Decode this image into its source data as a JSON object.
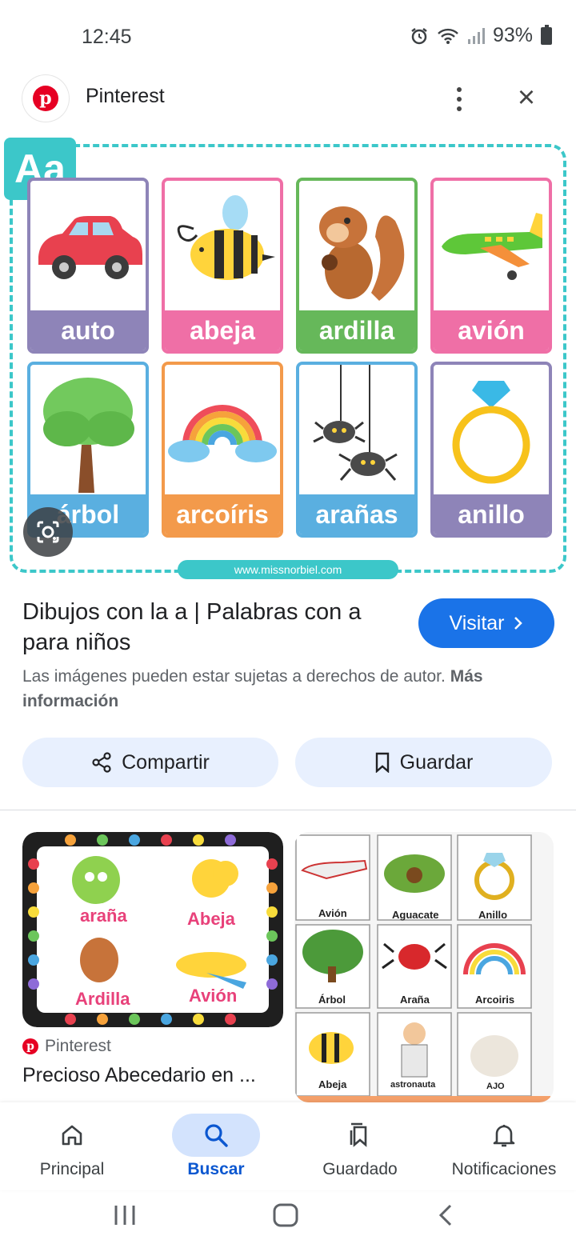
{
  "status_bar": {
    "time": "12:45",
    "battery": "93%"
  },
  "header": {
    "app_name": "Pinterest",
    "logo_letter": "p"
  },
  "hero": {
    "badge": "Aa",
    "website": "www.missnorbiel.com",
    "cards": [
      {
        "label": "auto",
        "color": "#8e84b8"
      },
      {
        "label": "abeja",
        "color": "#ef6fa6"
      },
      {
        "label": "ardilla",
        "color": "#66b85a"
      },
      {
        "label": "avión",
        "color": "#ef6fa6"
      },
      {
        "label": "árbol",
        "color": "#5aafe0"
      },
      {
        "label": "arcoíris",
        "color": "#f39a4b"
      },
      {
        "label": "arañas",
        "color": "#5aafe0"
      },
      {
        "label": "anillo",
        "color": "#8e84b8"
      }
    ]
  },
  "pin": {
    "title": "Dibujos con la a | Palabras con a para niños",
    "visit_label": "Visitar",
    "copyright_text": "Las imágenes pueden estar sujetas a derechos de autor.",
    "more_info": "Más información",
    "share_label": "Compartir",
    "save_label": "Guardar"
  },
  "related": {
    "result1": {
      "words": [
        "araña",
        "Abeja",
        "Ardilla",
        "Avión"
      ],
      "source": "Pinterest",
      "title": "Precioso Abecedario en ..."
    },
    "result2": {
      "words": [
        "Avión",
        "Aguacate",
        "Anillo",
        "Árbol",
        "Araña",
        "Arcoiris",
        "Abeja",
        "astronauta",
        "AJO"
      ]
    }
  },
  "bottom_nav": [
    {
      "label": "Principal",
      "icon": "home-icon"
    },
    {
      "label": "Buscar",
      "icon": "search-icon",
      "active": true
    },
    {
      "label": "Guardado",
      "icon": "bookmarks-icon"
    },
    {
      "label": "Notificaciones",
      "icon": "bell-icon"
    }
  ],
  "colors": {
    "accent": "#1a73e8",
    "pill": "#e8f0fe",
    "frame": "#3cc7c9",
    "pinterest": "#e60023"
  }
}
